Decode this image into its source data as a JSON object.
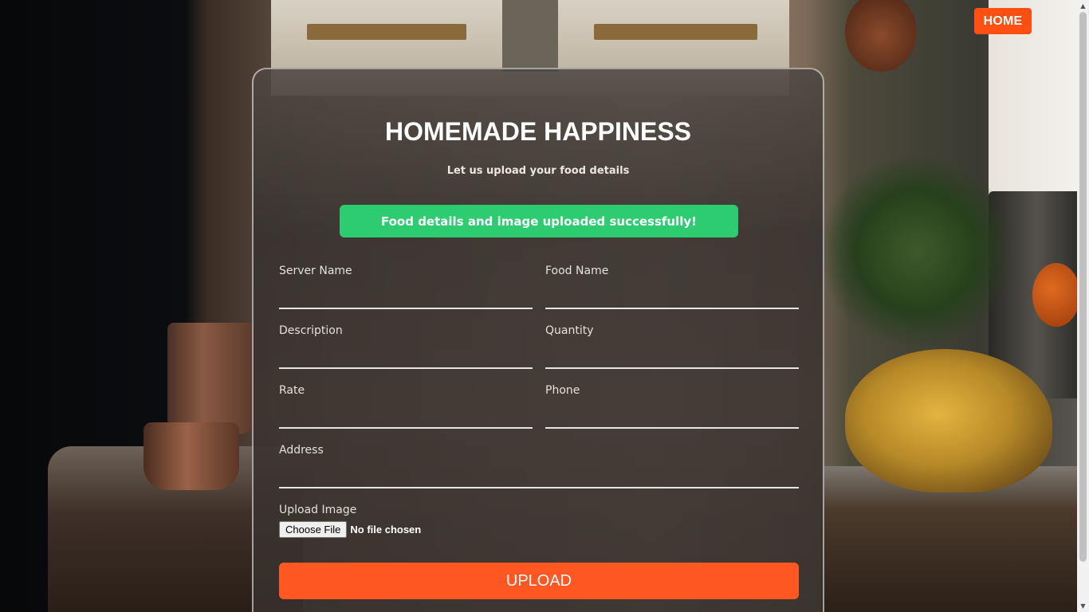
{
  "nav": {
    "home_label": "HOME"
  },
  "form": {
    "title": "HOMEMADE HAPPINESS",
    "subtitle": "Let us upload your food details",
    "success_message": "Food details and image uploaded successfully!",
    "fields": {
      "server_name": {
        "label": "Server Name",
        "value": ""
      },
      "food_name": {
        "label": "Food Name",
        "value": ""
      },
      "description": {
        "label": "Description",
        "value": ""
      },
      "quantity": {
        "label": "Quantity",
        "value": ""
      },
      "rate": {
        "label": "Rate",
        "value": ""
      },
      "phone": {
        "label": "Phone",
        "value": ""
      },
      "address": {
        "label": "Address",
        "value": ""
      }
    },
    "upload_image": {
      "label": "Upload Image",
      "button_label": "Choose File",
      "status": "No file chosen"
    },
    "submit_label": "UPLOAD"
  },
  "colors": {
    "accent": "#ff5722",
    "home_button": "#ff4f12",
    "success": "#2ecc71"
  }
}
